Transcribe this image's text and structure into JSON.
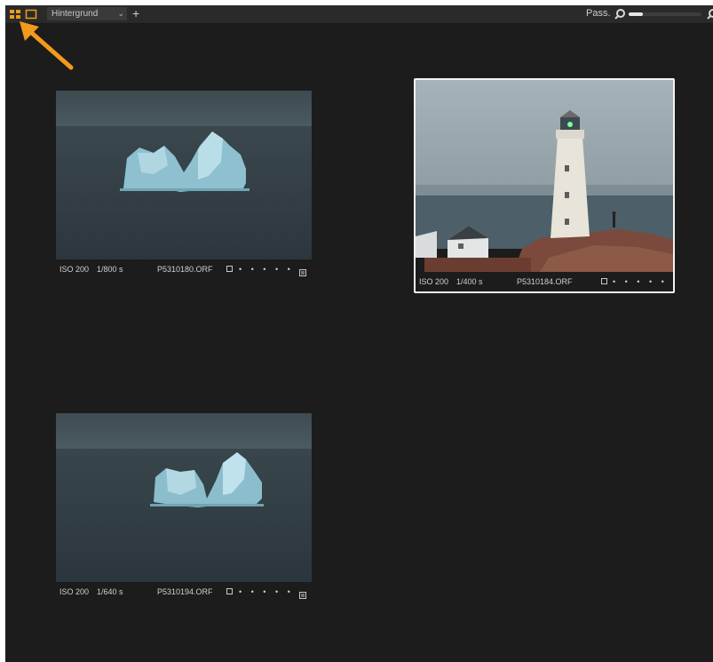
{
  "toolbar": {
    "background_dropdown": "Hintergrund",
    "add_label": "+",
    "fit_label": "Pass.",
    "zoom_fraction": 0.2
  },
  "colors": {
    "accent": "#f39a1b",
    "background": "#1c1c1c",
    "toolbar": "#2a2a2a"
  },
  "thumbnails": [
    {
      "iso": "ISO 200",
      "shutter": "1/800 s",
      "filename": "P5310180.ORF",
      "dots": "• • • • •",
      "selected": false
    },
    {
      "iso": "ISO 200",
      "shutter": "1/400 s",
      "filename": "P5310184.ORF",
      "dots": "• • • • •",
      "selected": true
    },
    {
      "iso": "ISO 200",
      "shutter": "1/640 s",
      "filename": "P5310194.ORF",
      "dots": "• • • • •",
      "selected": false
    }
  ]
}
